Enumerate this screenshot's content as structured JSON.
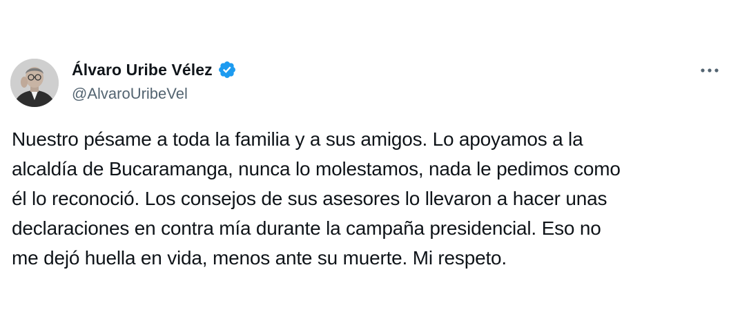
{
  "author": {
    "display_name": "Álvaro Uribe Vélez",
    "handle": "@AlvaroUribeVel",
    "verified": true,
    "verified_badge_icon": "verified-badge-icon",
    "avatar_icon": "avatar-photo"
  },
  "menu": {
    "more_icon": "more-horizontal-icon"
  },
  "tweet": {
    "text": "Nuestro pésame a toda la familia y a sus amigos. Lo apoyamos a la\nalcaldía de Bucaramanga, nunca lo molestamos, nada le pedimos como\nél lo reconoció. Los consejos de sus asesores lo llevaron a hacer unas\ndeclaraciones en contra mía durante la campaña presidencial. Eso no\nme dejó huella en vida, menos ante su muerte. Mi respeto."
  },
  "colors": {
    "verified_blue": "#1d9bf0",
    "handle_gray": "#536471",
    "text": "#0f1419",
    "background": "#ffffff"
  }
}
